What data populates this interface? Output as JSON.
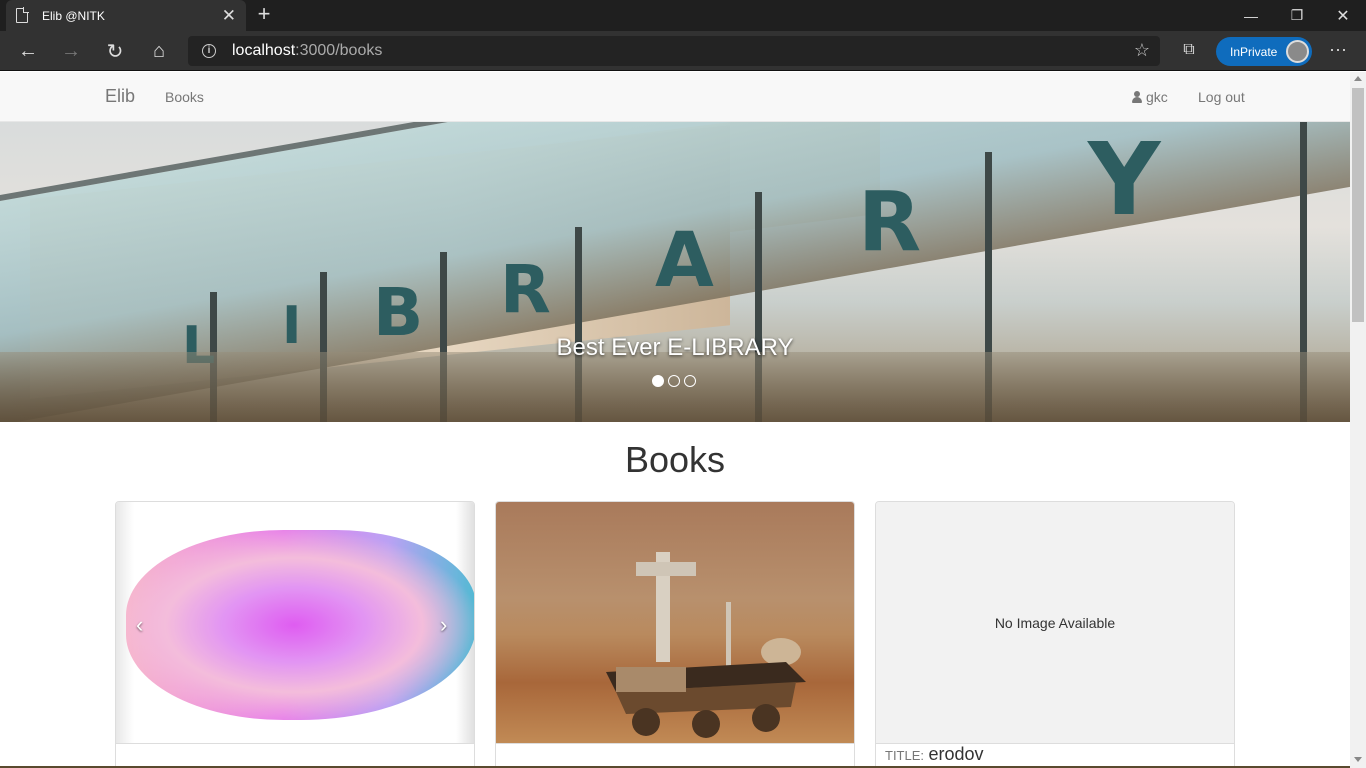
{
  "browser": {
    "tab_title": "Elib @NITK",
    "url_host": "localhost",
    "url_path": ":3000/books",
    "inprivate_label": "InPrivate"
  },
  "nav": {
    "brand": "Elib",
    "books_link": "Books",
    "user": "gkc",
    "logout": "Log out"
  },
  "carousel": {
    "caption": "Best Ever E-LIBRARY",
    "slide_count": 3,
    "active_slide": 1,
    "image_letters": [
      "L",
      "I",
      "B",
      "R",
      "A",
      "R",
      "Y"
    ]
  },
  "page_title": "Books",
  "books": [
    {
      "image": "paint-brush-stroke",
      "controls": [
        "‹",
        "›"
      ]
    },
    {
      "image": "mars-rover"
    },
    {
      "image_placeholder": "No Image Available",
      "title_label": "TITLE:",
      "title": "erodov"
    }
  ],
  "colors": {
    "browser_chrome": "#323232",
    "tabstrip": "#1f1f1f",
    "inprivate_badge": "#0f6cbd",
    "navbar_bg": "#f8f8f8",
    "navbar_text": "#777777"
  }
}
